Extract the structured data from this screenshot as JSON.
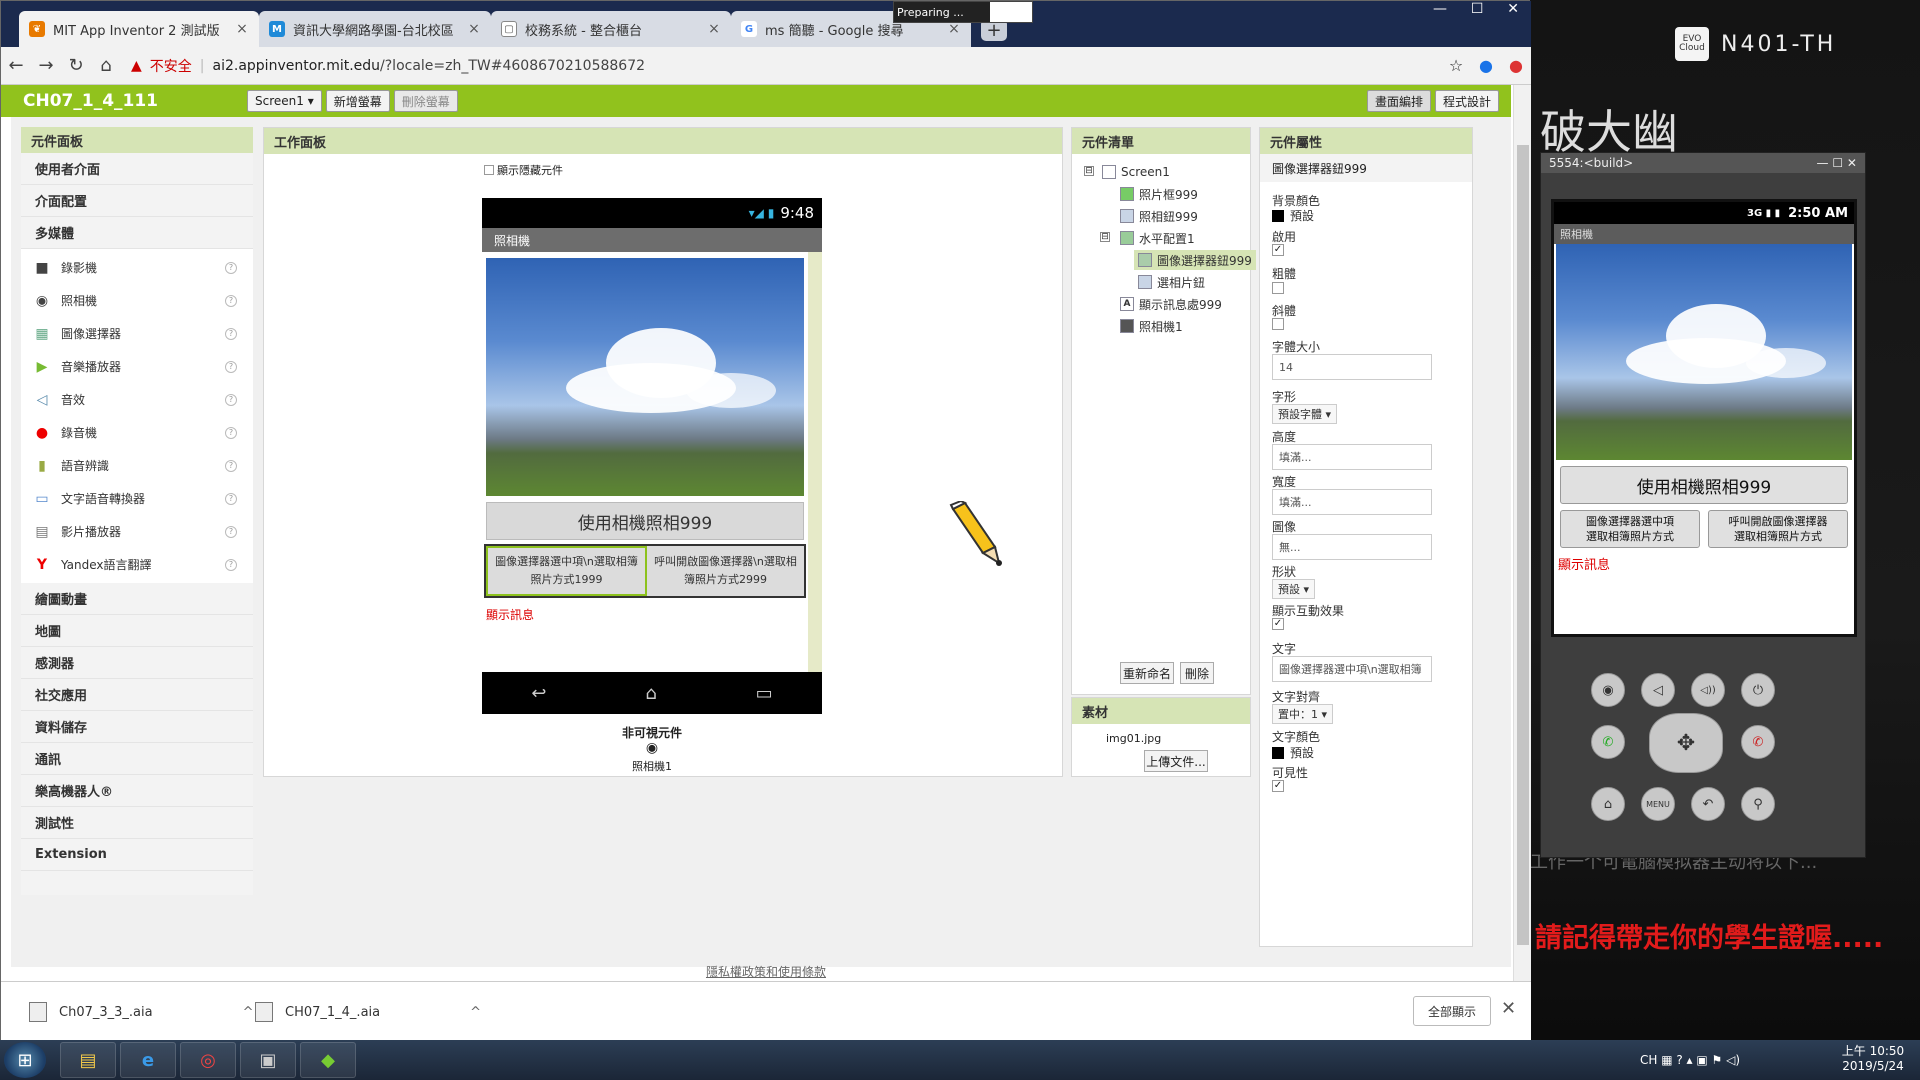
{
  "desktop": {
    "brand_logo": "EVO Cloud",
    "brand_text": "N401-TH",
    "calligraphy": "破大幽",
    "reminder": "請記得帶走你的學生證喔.....",
    "faint_text": "工作一个可電腦模拟器主动将以下..."
  },
  "browser": {
    "tabs": [
      {
        "title": "MIT App Inventor 2 測試版",
        "close": "×"
      },
      {
        "title": "資訊大學網路學園-台北校區",
        "close": "×"
      },
      {
        "title": "校務系統 - 整合櫃台",
        "close": "×"
      },
      {
        "title": "ms 簡聽 - Google 搜尋",
        "close": "×"
      }
    ],
    "new_tab": "+",
    "preparing": "Preparing ...",
    "window_controls": [
      "—",
      "☐",
      "✕"
    ],
    "nav": {
      "back": "←",
      "forward": "→",
      "reload": "↻",
      "home": "⌂"
    },
    "security_label": "不安全",
    "url_host": "ai2.appinventor.mit.edu",
    "url_rest": "/?locale=zh_TW#4608670210588672",
    "star": "☆"
  },
  "appbar": {
    "project_name": "CH07_1_4_111",
    "screen_select": "Screen1 ▾",
    "add_screen": "新增螢幕",
    "remove_screen": "刪除螢幕",
    "designer": "畫面編排",
    "blocks": "程式設計"
  },
  "palette": {
    "header": "元件面板",
    "categories_top": [
      "使用者介面",
      "介面配置",
      "多媒體"
    ],
    "media_items": [
      {
        "label": "錄影機",
        "icon": "■"
      },
      {
        "label": "照相機",
        "icon": "◉"
      },
      {
        "label": "圖像選擇器",
        "icon": "▦"
      },
      {
        "label": "音樂播放器",
        "icon": "▶"
      },
      {
        "label": "音效",
        "icon": "◁"
      },
      {
        "label": "錄音機",
        "icon": "●"
      },
      {
        "label": "語音辨識",
        "icon": "▮"
      },
      {
        "label": "文字語音轉換器",
        "icon": "▭"
      },
      {
        "label": "影片播放器",
        "icon": "▤"
      },
      {
        "label": "Yandex語言翻譯",
        "icon": "Y"
      }
    ],
    "help": "?",
    "categories_bottom": [
      "繪圖動畫",
      "地圖",
      "感測器",
      "社交應用",
      "資料儲存",
      "通訊",
      "樂高機器人®",
      "測試性",
      "Extension"
    ]
  },
  "viewer": {
    "header": "工作面板",
    "show_hidden": "顯示隱藏元件",
    "phone_time": "9:48",
    "phone_signal": "▾◢ ▮",
    "screen_title": "照相機",
    "camera_button": "使用相機照相999",
    "picker_button": "圖像選擇器選中項\\n選取相簿照片方式1999",
    "activity_button": "呼叫開啟圖像選擇器\\n選取相簿照片方式2999",
    "message_label": "顯示訊息",
    "nav_back": "↩",
    "nav_home": "⌂",
    "nav_recent": "▭",
    "nonvisible_title": "非可視元件",
    "nonvisible_icon": "◉",
    "nonvisible_item": "照相機1"
  },
  "components": {
    "header": "元件清單",
    "collapse": "⊟",
    "items": [
      "Screen1",
      "照片框999",
      "照相鈕999",
      "水平配置1",
      "圖像選擇器鈕999",
      "選相片鈕",
      "顯示訊息處999",
      "照相機1"
    ],
    "rename": "重新命名",
    "delete": "刪除"
  },
  "media": {
    "header": "素材",
    "file": "img01.jpg",
    "upload": "上傳文件..."
  },
  "properties": {
    "header": "元件屬性",
    "component": "圖像選擇器鈕999",
    "bg_label": "背景顏色",
    "bg_value": "預設",
    "enabled_label": "啟用",
    "bold_label": "粗體",
    "italic_label": "斜體",
    "fontsize_label": "字體大小",
    "fontsize_value": "14",
    "typeface_label": "字形",
    "typeface_value": "預設字體 ▾",
    "height_label": "高度",
    "height_value": "填滿...",
    "width_label": "寬度",
    "width_value": "填滿...",
    "image_label": "圖像",
    "image_value": "無...",
    "shape_label": "形狀",
    "shape_value": "預設 ▾",
    "feedback_label": "顯示互動效果",
    "text_label": "文字",
    "text_value": "圖像選擇器選中項\\n選取相簿",
    "align_label": "文字對齊",
    "align_value": "置中：1 ▾",
    "textcolor_label": "文字顏色",
    "textcolor_value": "預設",
    "visible_label": "可見性",
    "check": "✓"
  },
  "footer": {
    "privacy": "隱私權政策和使用條款",
    "downloads": [
      "Ch07_3_3_.aia",
      "CH07_1_4_.aia"
    ],
    "caret": "^",
    "show_all": "全部顯示",
    "close": "✕"
  },
  "emulator": {
    "title": "5554:<build>",
    "controls": "— ☐ ✕",
    "time": "2:50 AM",
    "status_icons": "3G ▮ ▮",
    "screen_title": "照相機",
    "camera_button": "使用相機照相999",
    "btn_left": "圖像選擇器選中項\n選取相簿照片方式",
    "btn_right": "呼叫開啟圖像選擇器\n選取相簿照片方式",
    "message": "顯示訊息",
    "hw_row1": [
      "◉",
      "◁",
      "◁))",
      "⏻"
    ],
    "hw_row2": [
      "✆",
      "✆"
    ],
    "hw_row3": [
      "⌂",
      "MENU",
      "↶",
      "⚲"
    ],
    "dpad": "✥"
  },
  "taskbar": {
    "start": "⊞",
    "apps": [
      "▤",
      "e",
      "◎",
      "▣",
      "◆"
    ],
    "tray": "CH ▦ ? ▴ ▣ ⚑ ◁)",
    "time": "上午 10:50",
    "date": "2019/5/24"
  },
  "colors": {
    "ai_green": "#91c21d",
    "panel_header": "#d6e4b5",
    "red_label": "#dd0000",
    "tabbar": "#1b2a4e"
  }
}
